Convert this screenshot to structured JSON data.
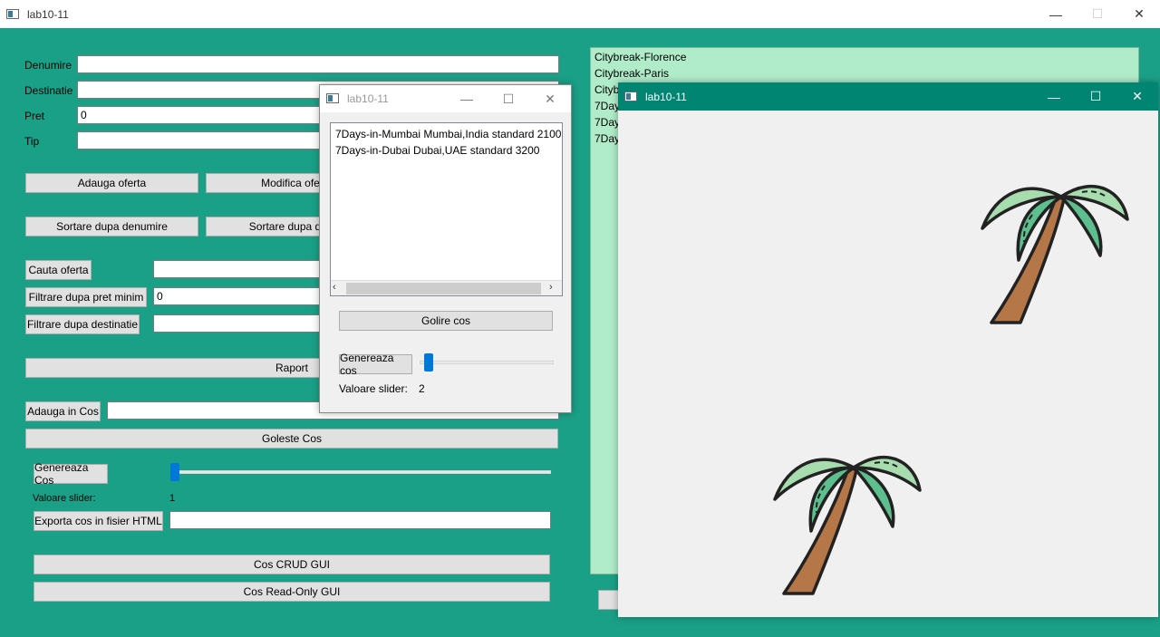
{
  "main_window": {
    "title": "lab10-11",
    "labels": {
      "denumire": "Denumire",
      "destinatie": "Destinatie",
      "pret": "Pret",
      "tip": "Tip"
    },
    "inputs": {
      "denumire": "",
      "destinatie": "",
      "pret": "0",
      "tip": ""
    },
    "buttons": {
      "adauga_oferta": "Adauga oferta",
      "modifica_oferta": "Modifica ofer",
      "sortare_denumire": "Sortare dupa denumire",
      "sortare_destinatie": "Sortare dupa dest",
      "cauta_oferta": "Cauta oferta",
      "filtrare_pret": "Filtrare dupa pret minim",
      "filtrare_destinatie": "Filtrare dupa destinatie",
      "raport": "Raport",
      "adauga_in_cos": "Adauga in Cos",
      "goleste_cos": "Goleste Cos",
      "genereaza_cos": "Genereaza Cos",
      "exporta_cos": "Exporta cos in fisier HTML",
      "cos_crud_gui": "Cos CRUD GUI",
      "cos_readonly_gui": "Cos Read-Only GUI"
    },
    "filter_pret_value": "0",
    "slider_label": "Valoare slider:",
    "slider_value": "1",
    "slider_fraction": 0.0,
    "offers_list": [
      "Citybreak-Florence",
      "Citybreak-Paris",
      "Cityb",
      "7Day",
      "7Day",
      "7Day"
    ]
  },
  "cos_window": {
    "title": "lab10-11",
    "items": [
      "7Days-in-Mumbai Mumbai,India standard 2100",
      "7Days-in-Dubai Dubai,UAE standard 3200"
    ],
    "golire_button": "Golire cos",
    "genereaza_button": "Genereaza cos",
    "slider_label": "Valoare slider:",
    "slider_value": "2"
  },
  "drawing_window": {
    "title": "lab10-11",
    "drawings": [
      "palm-tree",
      "palm-tree"
    ]
  },
  "window_controls": {
    "minimize": "—",
    "maximize": "☐",
    "close": "✕"
  },
  "colors": {
    "background": "#1aa087",
    "list_bg": "#b0ecc9",
    "drawing_titlebar": "#008573",
    "slider": "#0078d7"
  }
}
